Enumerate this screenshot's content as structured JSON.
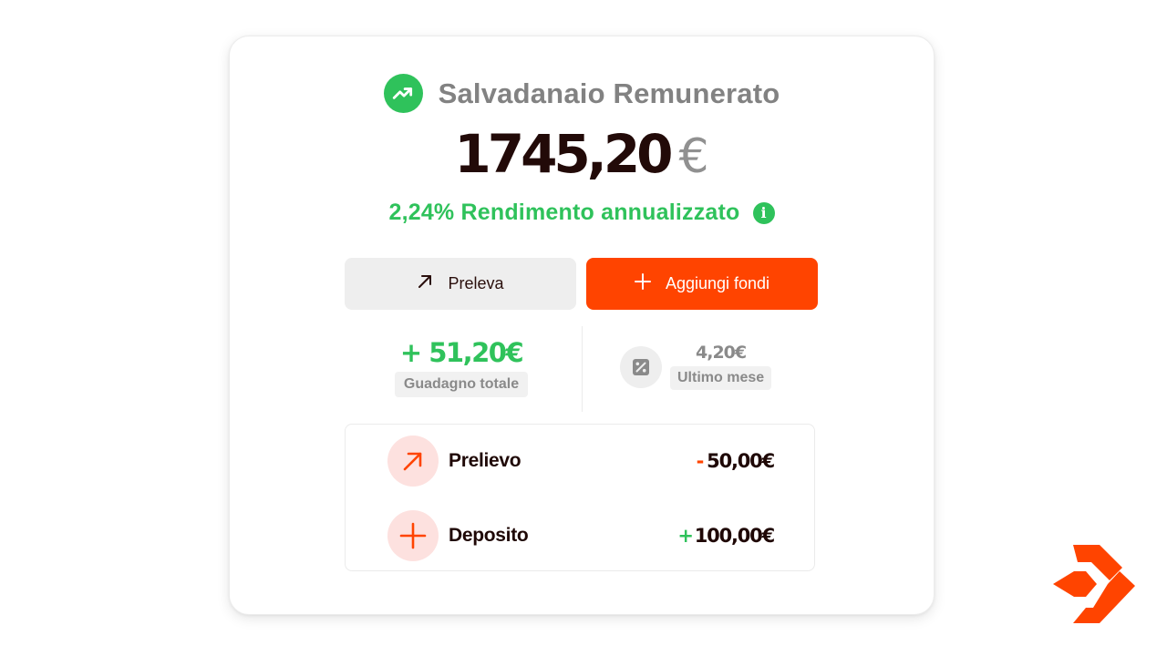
{
  "card": {
    "title": "Salvadanaio Remunerato",
    "title_icon": "trending-up-icon",
    "balance_amount": "1745,20",
    "balance_currency": "€",
    "yield_text": "2,24% Rendimento annualizzato",
    "yield_info_icon": "info-icon"
  },
  "actions": {
    "withdraw_label": "Preleva",
    "withdraw_icon": "arrow-up-right-icon",
    "add_label": "Aggiungi fondi",
    "add_icon": "plus-icon"
  },
  "stats": {
    "total_gain_value": "+ 51,20€",
    "total_gain_label": "Guadagno totale",
    "last_month_value": "4,20€",
    "last_month_label": "Ultimo mese",
    "last_month_icon": "percent-icon"
  },
  "transactions": [
    {
      "label": "Prelievo",
      "sign": "-",
      "amount": "50,00€",
      "icon": "arrow-up-right-icon"
    },
    {
      "label": "Deposito",
      "sign": "+",
      "amount": "100,00€",
      "icon": "plus-icon"
    }
  ],
  "colors": {
    "accent": "#ff4400",
    "positive": "#2fc25b",
    "text_dark": "#220a08",
    "muted": "#8a8a8a"
  }
}
